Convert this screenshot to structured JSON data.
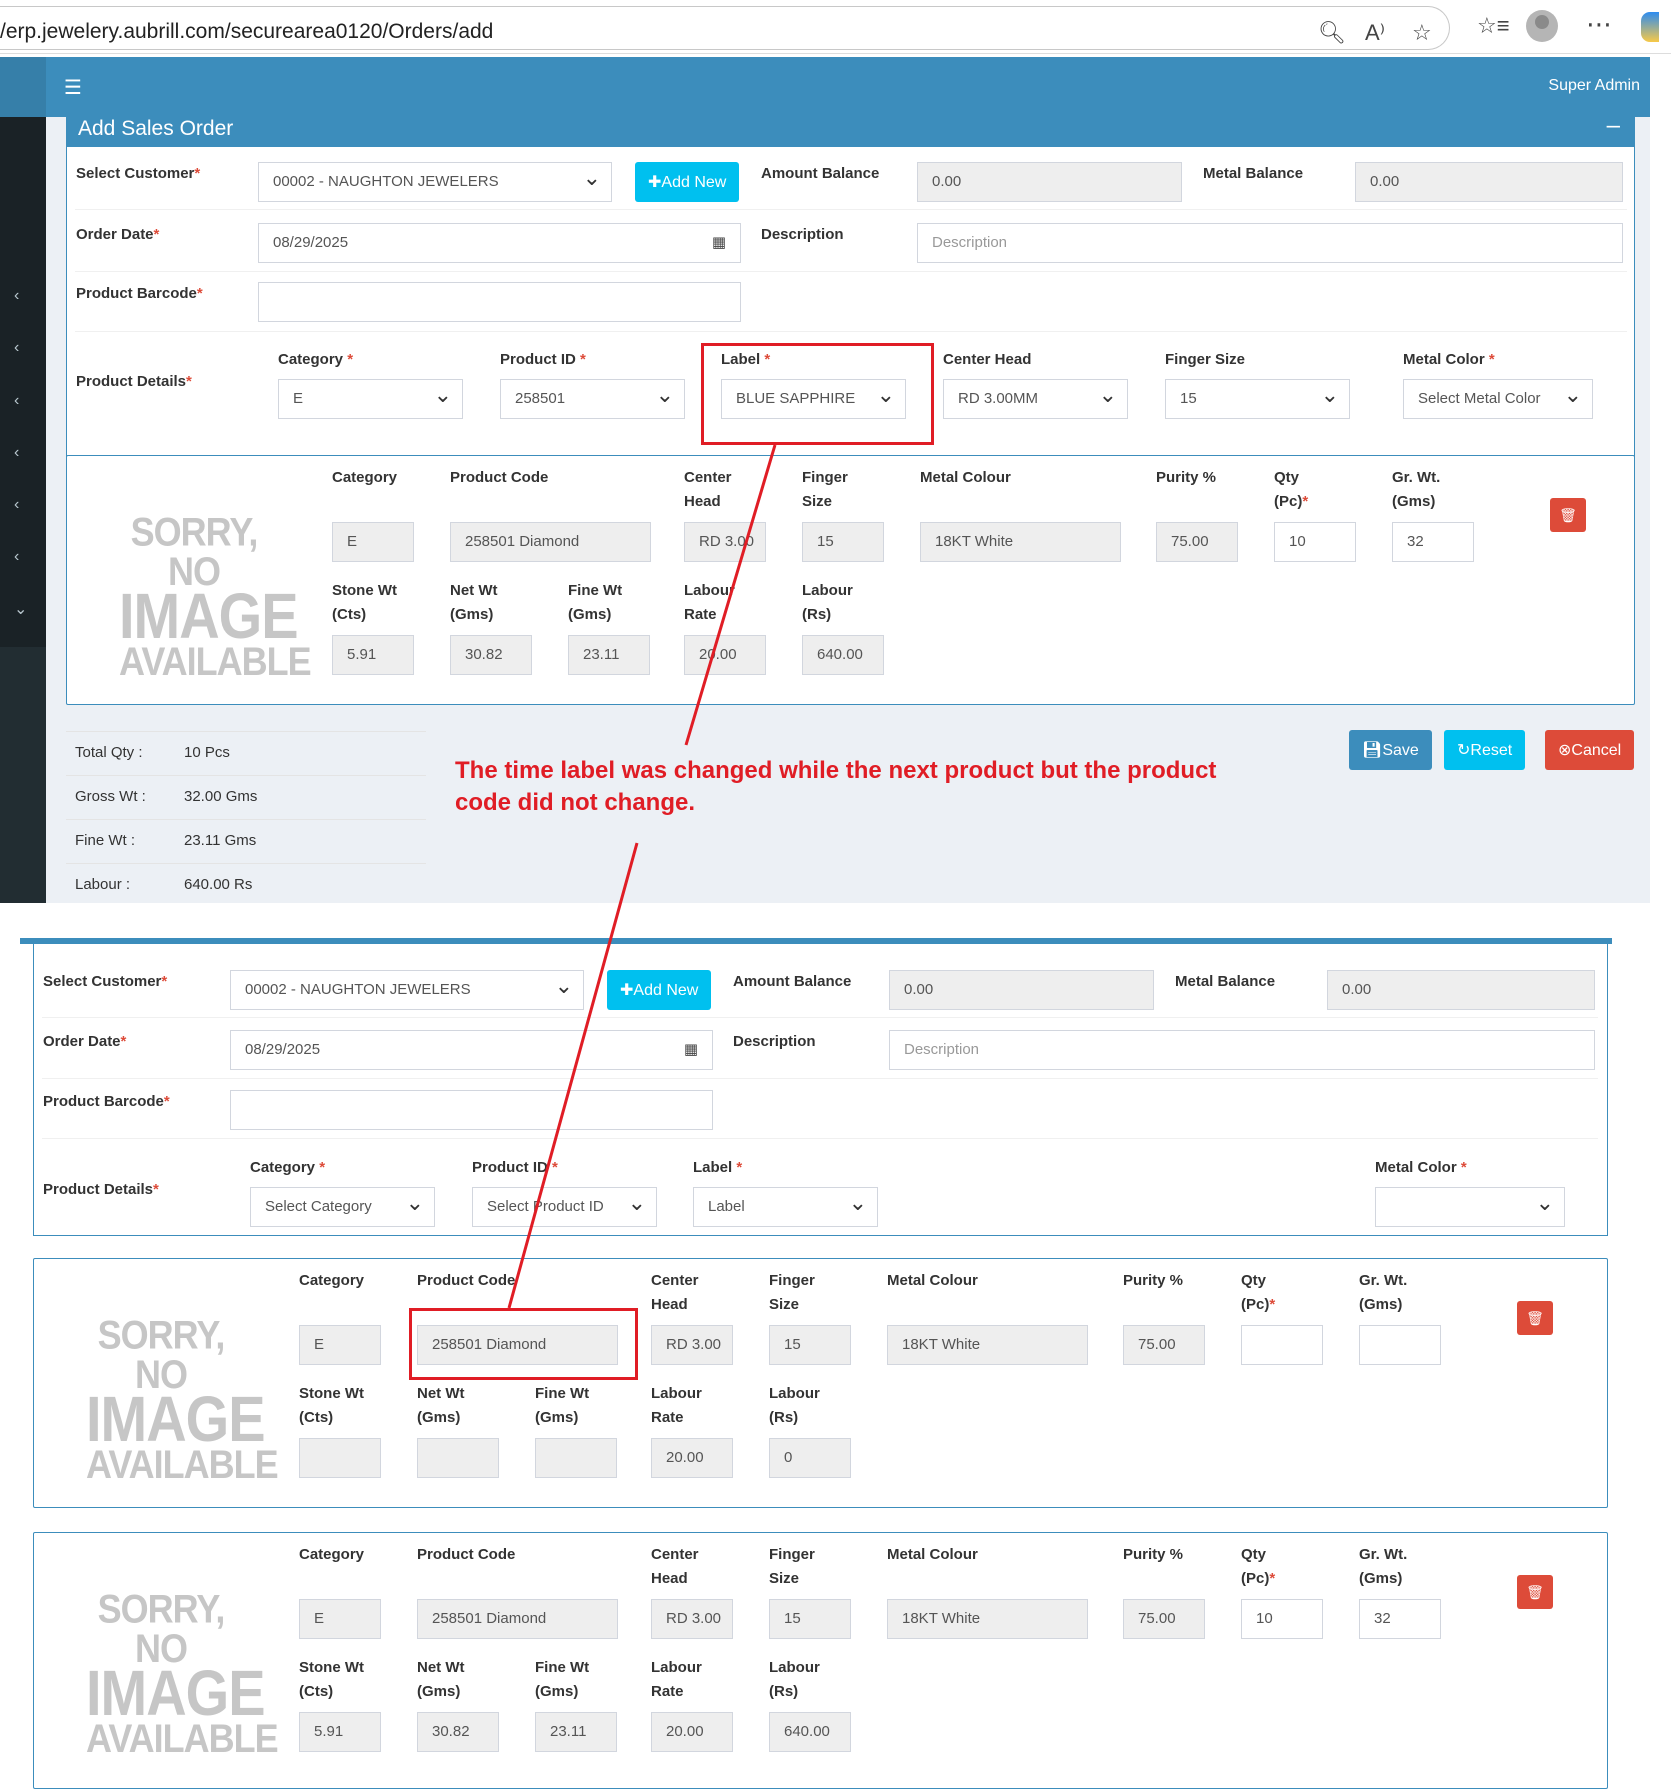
{
  "browser": {
    "url": "/erp.jewelery.aubrill.com/securearea0120/Orders/add"
  },
  "header": {
    "user": "Super Admin"
  },
  "panel": {
    "title": "Add Sales Order"
  },
  "form": {
    "select_customer_label": "Select Customer",
    "customer_value": "00002 - NAUGHTON JEWELERS",
    "add_new_label": "Add New",
    "amount_balance_label": "Amount Balance",
    "amount_balance_value": "0.00",
    "metal_balance_label": "Metal Balance",
    "metal_balance_value": "0.00",
    "order_date_label": "Order Date",
    "order_date_value": "08/29/2025",
    "description_label": "Description",
    "description_placeholder": "Description",
    "product_barcode_label": "Product Barcode",
    "product_details_label": "Product Details",
    "category_label": "Category",
    "product_id_label": "Product ID",
    "label_label": "Label",
    "center_head_label": "Center Head",
    "finger_size_label": "Finger Size",
    "metal_color_label": "Metal Color",
    "required_mark": "*"
  },
  "top_selection": {
    "category": "E",
    "product_id": "258501",
    "label": "BLUE SAPPHIRE",
    "center_head": "RD 3.00MM",
    "finger_size": "15",
    "metal_color": "Select Metal Color"
  },
  "bottom_selection": {
    "category": "Select Category",
    "product_id": "Select Product ID",
    "label": "Label",
    "metal_color": ""
  },
  "item_labels": {
    "category": "Category",
    "product_code": "Product Code",
    "center_head_1": "Center",
    "center_head_2": "Head",
    "finger_size_1": "Finger",
    "finger_size_2": "Size",
    "metal_colour": "Metal Colour",
    "purity": "Purity %",
    "qty_1": "Qty",
    "qty_2": "(Pc)",
    "grwt_1": "Gr. Wt.",
    "grwt_2": "(Gms)",
    "stone_wt_1": "Stone Wt",
    "stone_wt_2": "(Cts)",
    "net_wt_1": "Net Wt",
    "net_wt_2": "(Gms)",
    "fine_wt_1": "Fine Wt",
    "fine_wt_2": "(Gms)",
    "labour_rate_1": "Labour",
    "labour_rate_2": "Rate",
    "labour_rs_1": "Labour",
    "labour_rs_2": "(Rs)"
  },
  "no_image": {
    "line1": "SORRY, NO",
    "line2": "IMAGE",
    "line3": "AVAILABLE"
  },
  "items": [
    {
      "category": "E",
      "product_code": "258501 Diamond",
      "center_head": "RD 3.00",
      "finger_size": "15",
      "metal_colour": "18KT White",
      "purity": "75.00",
      "qty": "10",
      "gr_wt": "32",
      "stone_wt": "5.91",
      "net_wt": "30.82",
      "fine_wt": "23.11",
      "labour_rate": "20.00",
      "labour_rs": "640.00"
    },
    {
      "category": "E",
      "product_code": "258501 Diamond",
      "center_head": "RD 3.00",
      "finger_size": "15",
      "metal_colour": "18KT White",
      "purity": "75.00",
      "qty": "",
      "gr_wt": "",
      "stone_wt": "",
      "net_wt": "",
      "fine_wt": "",
      "labour_rate": "20.00",
      "labour_rs": "0"
    },
    {
      "category": "E",
      "product_code": "258501 Diamond",
      "center_head": "RD 3.00",
      "finger_size": "15",
      "metal_colour": "18KT White",
      "purity": "75.00",
      "qty": "10",
      "gr_wt": "32",
      "stone_wt": "5.91",
      "net_wt": "30.82",
      "fine_wt": "23.11",
      "labour_rate": "20.00",
      "labour_rs": "640.00"
    }
  ],
  "summary": {
    "total_qty_label": "Total Qty :",
    "total_qty": "10 Pcs",
    "gross_wt_label": "Gross Wt :",
    "gross_wt": "32.00 Gms",
    "fine_wt_label": "Fine Wt :",
    "fine_wt": "23.11 Gms",
    "labour_label": "Labour :",
    "labour": "640.00 Rs"
  },
  "actions": {
    "save": "Save",
    "reset": "Reset",
    "cancel": "Cancel"
  },
  "annotation": {
    "text": "The time label was changed while the next product but the product code did not change.",
    "color": "#e01d25"
  },
  "colors": {
    "primary": "#3c8dbc",
    "info": "#00c0ef",
    "danger": "#dd4b39",
    "sidebar": "#222d32"
  }
}
